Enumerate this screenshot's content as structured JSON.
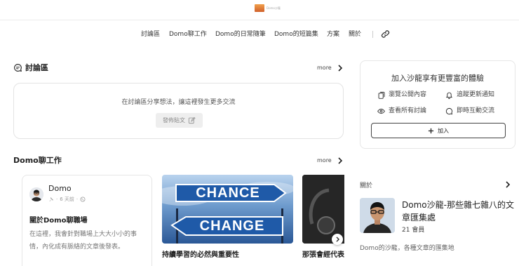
{
  "header": {
    "logo_text": "Domo沙龍"
  },
  "nav": {
    "items": [
      "討論區",
      "Domo聊工作",
      "Domo的日常隨筆",
      "Domo的短篇集",
      "方案",
      "關於"
    ]
  },
  "discussion": {
    "title": "討論區",
    "more": "more",
    "prompt": "在討論區分享想法，讓這裡發生更多交流",
    "post_button": "發佈貼文"
  },
  "work": {
    "title": "Domo聊工作",
    "more": "more",
    "post": {
      "author": "Domo",
      "time": "6 天前",
      "title": "關於Domo聊職場",
      "excerpt": "在這裡，我會針對職場上大大小小的事情，內化成有脈絡的文章後發表。"
    },
    "image_card": {
      "word_top": "CHANCE",
      "word_bottom": "CHANGE",
      "caption": "持續學習的必然與重要性"
    },
    "image_card2": {
      "caption": "那張會經代表的…"
    }
  },
  "join": {
    "title": "加入沙龍享有更豐富的體驗",
    "perks": [
      "瀏覽公開內容",
      "追蹤更新通知",
      "查看所有討論",
      "即時互動交流"
    ],
    "button": "加入"
  },
  "about": {
    "label": "關於",
    "name": "Domo沙龍-那些雜七雜八的文章匯集處",
    "count": "21 會員",
    "desc": "Domo的沙龍，各種文章的匯集地"
  }
}
